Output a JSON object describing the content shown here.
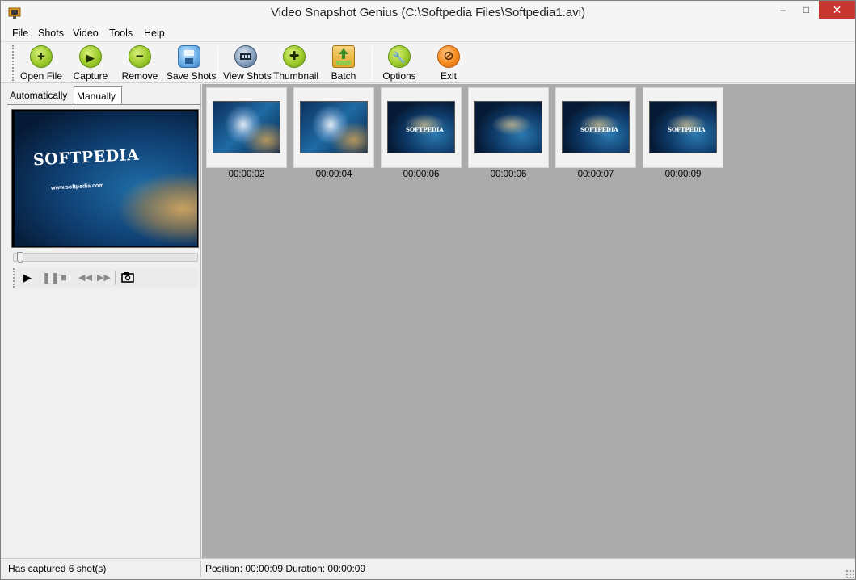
{
  "window": {
    "title": "Video Snapshot Genius (C:\\Softpedia Files\\Softpedia1.avi)",
    "min_glyph": "–",
    "max_glyph": "□",
    "close_glyph": "✕"
  },
  "menu": {
    "items": [
      "File",
      "Shots",
      "Video",
      "Tools",
      "Help"
    ]
  },
  "toolbar": {
    "open_file": "Open File",
    "capture": "Capture",
    "remove": "Remove",
    "save_shots": "Save Shots",
    "view_shots": "View Shots",
    "thumbnail": "Thumbnail",
    "batch": "Batch",
    "options": "Options",
    "exit": "Exit",
    "icons": {
      "open_file": "plus-circle-icon",
      "capture": "play-circle-icon",
      "remove": "minus-circle-icon",
      "save_shots": "floppy-disk-icon",
      "view_shots": "film-strip-icon",
      "thumbnail": "grid-plus-icon",
      "batch": "batch-folder-icon",
      "options": "wrench-icon",
      "exit": "stop-circle-icon"
    }
  },
  "left_panel": {
    "tabs": [
      "Automatically",
      "Manually"
    ],
    "active_tab": "Manually",
    "preview_logo": "SOFTPEDIA",
    "preview_url": "www.softpedia.com",
    "seek_position": 0.0,
    "controls": [
      "play",
      "pause",
      "stop",
      "rewind",
      "fast-forward",
      "snapshot"
    ]
  },
  "gallery": {
    "shots": [
      {
        "time": "00:00:02",
        "overlay": ""
      },
      {
        "time": "00:00:04",
        "overlay": ""
      },
      {
        "time": "00:00:06",
        "overlay": "SOFTPEDIA"
      },
      {
        "time": "00:00:06",
        "overlay": ""
      },
      {
        "time": "00:00:07",
        "overlay": "SOFTPEDIA"
      },
      {
        "time": "00:00:09",
        "overlay": "SOFTPEDIA"
      }
    ]
  },
  "status": {
    "left": "Has captured 6 shot(s)",
    "right": "Position: 00:00:09 Duration: 00:00:09"
  },
  "colors": {
    "gallery_bg": "#ababab",
    "close_button": "#c7372f",
    "toolbar_green": "#9dcb2b",
    "toolbar_orange": "#f58a1f"
  }
}
